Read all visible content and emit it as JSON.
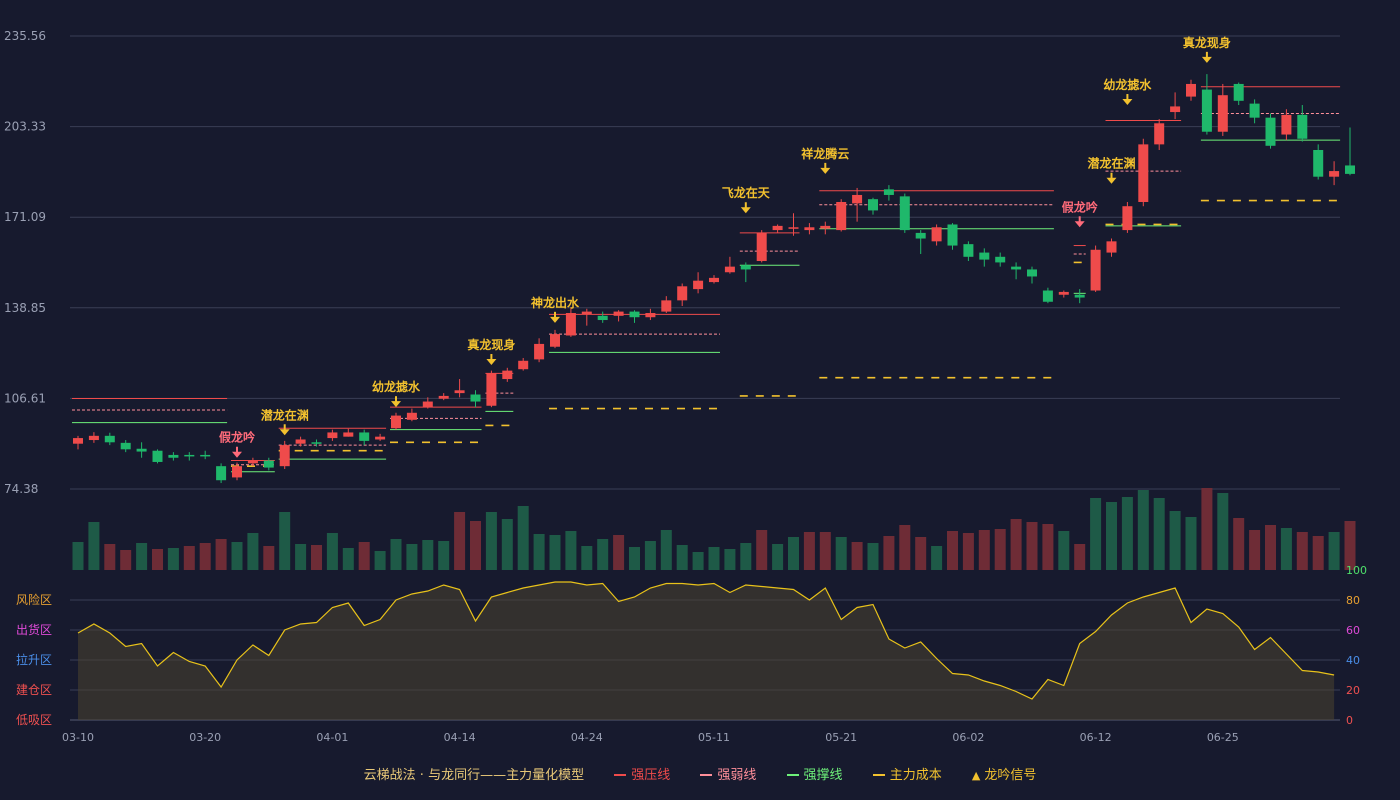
{
  "chart_data": {
    "type": "candlestick",
    "y_ticks": [
      "235.56",
      "203.33",
      "171.09",
      "138.85",
      "106.61",
      "74.38"
    ],
    "ylim": [
      74.38,
      235.56
    ],
    "x_ticks": [
      {
        "i": 0,
        "label": "03-10"
      },
      {
        "i": 8,
        "label": "03-20"
      },
      {
        "i": 16,
        "label": "04-01"
      },
      {
        "i": 24,
        "label": "04-14"
      },
      {
        "i": 32,
        "label": "04-24"
      },
      {
        "i": 40,
        "label": "05-11"
      },
      {
        "i": 48,
        "label": "05-21"
      },
      {
        "i": 56,
        "label": "06-02"
      },
      {
        "i": 64,
        "label": "06-12"
      },
      {
        "i": 72,
        "label": "06-25"
      }
    ],
    "candles": [
      [
        90.5,
        92.5,
        88.5,
        93.3
      ],
      [
        91.8,
        93.3,
        90.8,
        94.6
      ],
      [
        93.3,
        91.0,
        90.0,
        94.4
      ],
      [
        90.8,
        88.5,
        87.5,
        91.8
      ],
      [
        88.7,
        87.7,
        85.5,
        91.0
      ],
      [
        88.0,
        84.0,
        83.5,
        88.5
      ],
      [
        86.5,
        85.5,
        84.5,
        87.5
      ],
      [
        86.5,
        86.0,
        84.5,
        87.5
      ],
      [
        86.5,
        86.0,
        85.0,
        88.0
      ],
      [
        82.5,
        77.5,
        76.5,
        83.5
      ],
      [
        78.5,
        82.5,
        77.5,
        83.8
      ],
      [
        83.5,
        84.5,
        82.5,
        85.5
      ],
      [
        84.5,
        82.0,
        81.0,
        85.5
      ],
      [
        82.5,
        90.0,
        81.5,
        91.5
      ],
      [
        90.5,
        92.0,
        89.5,
        93.0
      ],
      [
        91.0,
        90.5,
        89.5,
        92.0
      ],
      [
        92.5,
        94.5,
        91.5,
        95.5
      ],
      [
        93.0,
        94.5,
        93.0,
        95.8
      ],
      [
        94.5,
        91.5,
        90.0,
        95.5
      ],
      [
        92.0,
        93.0,
        91.5,
        94.0
      ],
      [
        96.0,
        100.5,
        95.5,
        101.5
      ],
      [
        99.0,
        101.5,
        98.5,
        103.0
      ],
      [
        103.5,
        105.5,
        103.0,
        107.0
      ],
      [
        106.5,
        107.5,
        106.0,
        108.5
      ],
      [
        108.5,
        109.5,
        107.0,
        113.5
      ],
      [
        108.0,
        105.5,
        103.5,
        109.5
      ],
      [
        104.0,
        115.5,
        103.5,
        116.5
      ],
      [
        113.5,
        116.5,
        112.5,
        117.5
      ],
      [
        117.0,
        120.0,
        116.5,
        121.0
      ],
      [
        120.5,
        126.0,
        119.5,
        128.0
      ],
      [
        125.0,
        129.5,
        124.5,
        131.0
      ],
      [
        129.0,
        137.0,
        128.5,
        139.0
      ],
      [
        136.5,
        137.5,
        132.5,
        138.5
      ],
      [
        136.0,
        134.5,
        133.5,
        137.5
      ],
      [
        136.0,
        137.5,
        134.0,
        138.0
      ],
      [
        137.5,
        135.5,
        133.5,
        138.0
      ],
      [
        135.5,
        137.0,
        134.5,
        138.5
      ],
      [
        137.5,
        141.5,
        137.0,
        143.0
      ],
      [
        141.5,
        146.5,
        139.5,
        147.5
      ],
      [
        145.5,
        148.5,
        144.0,
        151.5
      ],
      [
        148.0,
        149.5,
        147.5,
        150.5
      ],
      [
        151.5,
        153.5,
        151.0,
        157.0
      ],
      [
        154.0,
        152.5,
        148.0,
        155.0
      ],
      [
        155.5,
        165.5,
        155.0,
        166.5
      ],
      [
        166.5,
        168.0,
        165.5,
        168.5
      ],
      [
        167.0,
        167.5,
        164.5,
        172.5
      ],
      [
        166.5,
        167.5,
        165.0,
        169.0
      ],
      [
        167.0,
        168.0,
        165.0,
        169.5
      ],
      [
        166.5,
        176.5,
        166.0,
        177.5
      ],
      [
        176.0,
        179.0,
        169.5,
        181.5
      ],
      [
        177.5,
        173.5,
        172.0,
        178.0
      ],
      [
        181.0,
        179.0,
        177.0,
        182.5
      ],
      [
        178.5,
        166.5,
        165.5,
        179.5
      ],
      [
        165.5,
        163.5,
        158.0,
        166.5
      ],
      [
        162.5,
        167.5,
        161.0,
        168.5
      ],
      [
        168.5,
        161.0,
        159.5,
        169.0
      ],
      [
        161.5,
        157.0,
        155.5,
        162.5
      ],
      [
        158.5,
        156.0,
        153.5,
        160.0
      ],
      [
        157.0,
        155.0,
        153.5,
        158.5
      ],
      [
        153.5,
        152.5,
        149.0,
        155.0
      ],
      [
        152.5,
        150.0,
        147.5,
        153.5
      ],
      [
        145.0,
        141.0,
        140.5,
        146.0
      ],
      [
        143.5,
        144.5,
        142.5,
        145.0
      ],
      [
        143.5,
        142.5,
        140.5,
        145.5
      ],
      [
        145.0,
        159.5,
        144.5,
        161.0
      ],
      [
        158.5,
        162.5,
        157.0,
        163.5
      ],
      [
        166.5,
        175.0,
        165.5,
        176.5
      ],
      [
        176.5,
        197.0,
        175.0,
        199.0
      ],
      [
        197.0,
        204.5,
        195.0,
        206.0
      ],
      [
        208.5,
        210.5,
        206.0,
        215.5
      ],
      [
        214.0,
        218.5,
        212.5,
        220.0
      ],
      [
        216.5,
        201.5,
        200.5,
        222.0
      ],
      [
        201.5,
        214.5,
        200.0,
        218.5
      ],
      [
        218.5,
        212.5,
        211.0,
        219.0
      ],
      [
        211.5,
        206.5,
        204.5,
        213.0
      ],
      [
        206.5,
        196.5,
        195.5,
        208.0
      ],
      [
        200.5,
        207.5,
        198.5,
        209.5
      ],
      [
        207.5,
        199.0,
        198.0,
        211.0
      ],
      [
        195.0,
        185.5,
        184.5,
        197.0
      ],
      [
        185.5,
        187.5,
        182.5,
        191.0
      ],
      [
        189.5,
        186.5,
        186.0,
        203.0
      ]
    ],
    "volume": [
      {
        "v": 28,
        "c": "g"
      },
      {
        "v": 48,
        "c": "g"
      },
      {
        "v": 26,
        "c": "r"
      },
      {
        "v": 20,
        "c": "r"
      },
      {
        "v": 27,
        "c": "g"
      },
      {
        "v": 21,
        "c": "r"
      },
      {
        "v": 22,
        "c": "g"
      },
      {
        "v": 24,
        "c": "r"
      },
      {
        "v": 27,
        "c": "r"
      },
      {
        "v": 31,
        "c": "r"
      },
      {
        "v": 28,
        "c": "g"
      },
      {
        "v": 37,
        "c": "g"
      },
      {
        "v": 24,
        "c": "r"
      },
      {
        "v": 58,
        "c": "g"
      },
      {
        "v": 26,
        "c": "g"
      },
      {
        "v": 25,
        "c": "r"
      },
      {
        "v": 37,
        "c": "g"
      },
      {
        "v": 22,
        "c": "g"
      },
      {
        "v": 28,
        "c": "r"
      },
      {
        "v": 19,
        "c": "g"
      },
      {
        "v": 31,
        "c": "g"
      },
      {
        "v": 26,
        "c": "g"
      },
      {
        "v": 30,
        "c": "g"
      },
      {
        "v": 29,
        "c": "g"
      },
      {
        "v": 58,
        "c": "r"
      },
      {
        "v": 49,
        "c": "r"
      },
      {
        "v": 58,
        "c": "g"
      },
      {
        "v": 51,
        "c": "g"
      },
      {
        "v": 64,
        "c": "g"
      },
      {
        "v": 36,
        "c": "g"
      },
      {
        "v": 35,
        "c": "g"
      },
      {
        "v": 39,
        "c": "g"
      },
      {
        "v": 24,
        "c": "g"
      },
      {
        "v": 31,
        "c": "g"
      },
      {
        "v": 35,
        "c": "r"
      },
      {
        "v": 23,
        "c": "g"
      },
      {
        "v": 29,
        "c": "g"
      },
      {
        "v": 40,
        "c": "g"
      },
      {
        "v": 25,
        "c": "g"
      },
      {
        "v": 18,
        "c": "g"
      },
      {
        "v": 23,
        "c": "g"
      },
      {
        "v": 21,
        "c": "g"
      },
      {
        "v": 27,
        "c": "g"
      },
      {
        "v": 40,
        "c": "r"
      },
      {
        "v": 26,
        "c": "g"
      },
      {
        "v": 33,
        "c": "g"
      },
      {
        "v": 38,
        "c": "r"
      },
      {
        "v": 38,
        "c": "r"
      },
      {
        "v": 33,
        "c": "g"
      },
      {
        "v": 28,
        "c": "r"
      },
      {
        "v": 27,
        "c": "g"
      },
      {
        "v": 34,
        "c": "r"
      },
      {
        "v": 45,
        "c": "r"
      },
      {
        "v": 33,
        "c": "r"
      },
      {
        "v": 24,
        "c": "g"
      },
      {
        "v": 39,
        "c": "r"
      },
      {
        "v": 37,
        "c": "r"
      },
      {
        "v": 40,
        "c": "r"
      },
      {
        "v": 41,
        "c": "r"
      },
      {
        "v": 51,
        "c": "r"
      },
      {
        "v": 48,
        "c": "r"
      },
      {
        "v": 46,
        "c": "r"
      },
      {
        "v": 39,
        "c": "g"
      },
      {
        "v": 26,
        "c": "r"
      },
      {
        "v": 72,
        "c": "g"
      },
      {
        "v": 68,
        "c": "g"
      },
      {
        "v": 73,
        "c": "g"
      },
      {
        "v": 80,
        "c": "g"
      },
      {
        "v": 72,
        "c": "g"
      },
      {
        "v": 59,
        "c": "g"
      },
      {
        "v": 53,
        "c": "g"
      },
      {
        "v": 82,
        "c": "r"
      },
      {
        "v": 77,
        "c": "g"
      },
      {
        "v": 52,
        "c": "r"
      },
      {
        "v": 40,
        "c": "r"
      },
      {
        "v": 45,
        "c": "r"
      },
      {
        "v": 42,
        "c": "g"
      },
      {
        "v": 38,
        "c": "r"
      },
      {
        "v": 34,
        "c": "r"
      },
      {
        "v": 38,
        "c": "g"
      },
      {
        "v": 49,
        "c": "r"
      }
    ],
    "oscillator": [
      58,
      64,
      58,
      49,
      51,
      36,
      45,
      39,
      36,
      22,
      40,
      50,
      43,
      60,
      64,
      65,
      75,
      78,
      63,
      67,
      80,
      84,
      86,
      90,
      87,
      66,
      82,
      85,
      88,
      90,
      92,
      92,
      90,
      91,
      79,
      82,
      88,
      91,
      91,
      90,
      91,
      85,
      90,
      89,
      88,
      87,
      80,
      88,
      67,
      75,
      77,
      54,
      48,
      52,
      41,
      31,
      30,
      26,
      23,
      19,
      14,
      27,
      23,
      51,
      59,
      70,
      78,
      82,
      85,
      88,
      65,
      74,
      71,
      62,
      47,
      55,
      44,
      33,
      32,
      30
    ],
    "osc_ticks": [
      "100",
      "80",
      "60",
      "40",
      "20",
      "0"
    ],
    "zones": [
      "风险区",
      "出货区",
      "拉升区",
      "建仓区",
      "低吸区"
    ],
    "signals": [
      {
        "i": 10,
        "text": "假龙吟",
        "y": 85.5,
        "color": "#ff6b7a"
      },
      {
        "i": 13,
        "text": "潜龙在渊",
        "y": 93.5,
        "color": "#f2c12e"
      },
      {
        "i": 20,
        "text": "幼龙摅水",
        "y": 103.5,
        "color": "#f2c12e"
      },
      {
        "i": 26,
        "text": "真龙现身",
        "y": 118.5,
        "color": "#f2c12e"
      },
      {
        "i": 30,
        "text": "神龙出水",
        "y": 133.5,
        "color": "#f2c12e"
      },
      {
        "i": 42,
        "text": "飞龙在天",
        "y": 172.5,
        "color": "#f2c12e"
      },
      {
        "i": 47,
        "text": "祥龙腾云",
        "y": 186.5,
        "color": "#f2c12e"
      },
      {
        "i": 63,
        "text": "假龙吟",
        "y": 167.5,
        "color": "#ff6b7a"
      },
      {
        "i": 65,
        "text": "潜龙在渊",
        "y": 183.0,
        "color": "#f2c12e"
      },
      {
        "i": 66,
        "text": "幼龙摅水",
        "y": 211.0,
        "color": "#f2c12e"
      },
      {
        "i": 71,
        "text": "真龙现身",
        "y": 226.0,
        "color": "#f2c12e"
      }
    ],
    "levels": [
      {
        "from": 0,
        "to": 9,
        "res": 106.6,
        "weak": 102.5,
        "sup": 98.0
      },
      {
        "from": 10,
        "to": 12,
        "res": 84.5,
        "weak": 83.0,
        "sup": 80.5,
        "cost": 82.5
      },
      {
        "from": 13,
        "to": 19,
        "res": 96.0,
        "weak": 90.0,
        "sup": 85.0,
        "cost": 88.0
      },
      {
        "from": 20,
        "to": 25,
        "res": 103.5,
        "weak": 99.5,
        "sup": 95.5,
        "cost": 91.0
      },
      {
        "from": 26,
        "to": 27,
        "res": 115.5,
        "weak": 108.5,
        "sup": 102.0,
        "cost": 97.0
      },
      {
        "from": 30,
        "to": 40,
        "res": 136.5,
        "weak": 129.5,
        "sup": 123.0,
        "cost": 103.0
      },
      {
        "from": 42,
        "to": 45,
        "res": 165.5,
        "weak": 159.0,
        "sup": 154.0,
        "cost": 107.5
      },
      {
        "from": 47,
        "to": 61,
        "res": 180.5,
        "weak": 175.5,
        "sup": 167.0,
        "cost": 114.0
      },
      {
        "from": 63,
        "to": 63,
        "res": 161.0,
        "weak": 158.0,
        "sup": 144.0,
        "cost": 155.0
      },
      {
        "from": 65,
        "to": 69,
        "res": 205.5,
        "weak": 187.5,
        "sup": 168.0,
        "cost": 168.5
      },
      {
        "from": 71,
        "to": 79,
        "res": 217.5,
        "weak": 208.0,
        "sup": 198.5,
        "cost": 177.0
      }
    ]
  },
  "legend": {
    "title": "云梯战法 · 与龙同行——主力量化模型",
    "resistance": "强压线",
    "weak": "强弱线",
    "support": "强撑线",
    "cost": "主力成本",
    "signal": "龙吟信号"
  },
  "colors": {
    "up": "#ef4b4b",
    "down": "#1fb86b",
    "resistance": "#ef4b4b",
    "weak": "#ff8f9a",
    "support": "#6ef07a",
    "cost": "#f2c12e",
    "osc": "#e8c21a",
    "vol_up": "#6e2c36",
    "vol_down": "#1e5a47"
  }
}
